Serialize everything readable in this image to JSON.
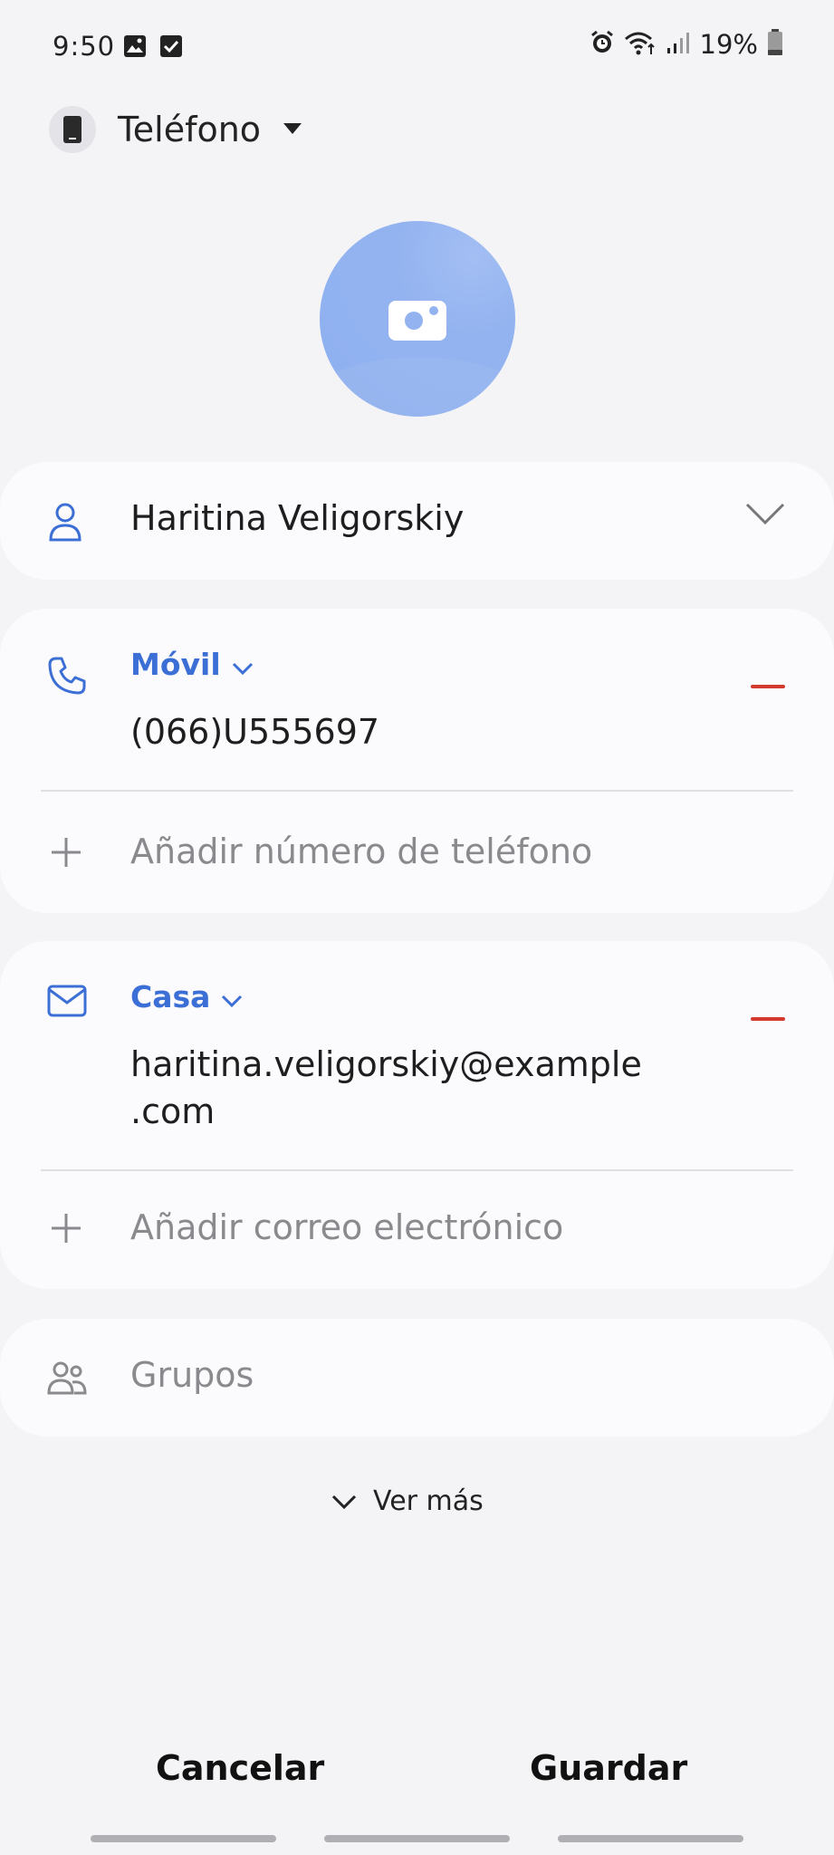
{
  "status_bar": {
    "time": "9:50",
    "battery": "19%",
    "icons": [
      "gallery-icon",
      "check-icon",
      "alarm-icon",
      "wifi-icon",
      "signal-icon",
      "battery-icon"
    ]
  },
  "storage": {
    "label": "Teléfono",
    "icon": "phone-device-icon"
  },
  "photo": {
    "icon": "camera-icon",
    "color": "#93b3f0"
  },
  "name": {
    "value": "Haritina Veligorskiy",
    "icon": "person-icon"
  },
  "phone": {
    "type": "Móvil",
    "value": "(066)U555697",
    "add_placeholder": "Añadir número de teléfono",
    "icon": "phone-icon"
  },
  "email": {
    "type": "Casa",
    "value_line1": "haritina.veligorskiy@example",
    "value_line2": ".com",
    "add_placeholder": "Añadir correo electrónico",
    "icon": "mail-icon"
  },
  "groups": {
    "label": "Grupos",
    "icon": "groups-icon"
  },
  "more": {
    "label": "Ver más"
  },
  "actions": {
    "cancel": "Cancelar",
    "save": "Guardar"
  },
  "colors": {
    "accent": "#3c6fd6",
    "remove": "#d23a2e",
    "background": "#f4f4f7",
    "card": "#fbfbfd"
  }
}
